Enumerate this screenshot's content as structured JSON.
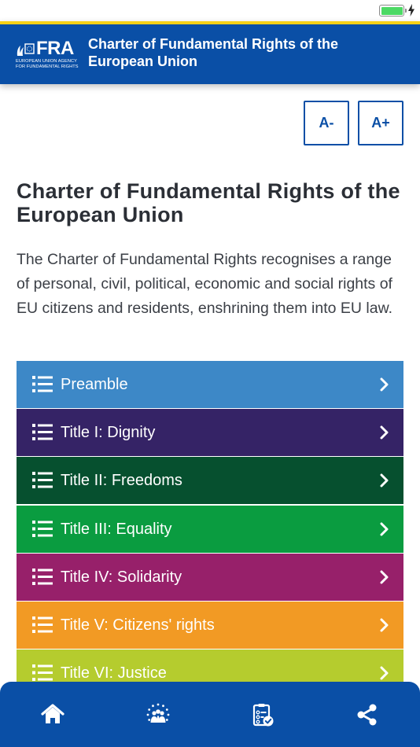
{
  "header": {
    "logo_text": "FRA",
    "logo_subtext_line1": "EUROPEAN UNION AGENCY",
    "logo_subtext_line2": "FOR FUNDAMENTAL RIGHTS",
    "title_line1": "Charter of Fundamental Rights of the",
    "title_line2": "European Union"
  },
  "font_controls": {
    "decrease_label": "A-",
    "increase_label": "A+"
  },
  "main": {
    "title": "Charter of Fundamental Rights of the European Union",
    "description": "The Charter of Fundamental Rights recognises a range of personal, civil, political, economic and social rights of EU citizens and residents, enshrining them into EU law."
  },
  "menu": {
    "items": [
      {
        "label": "Preamble",
        "color": "#3d88c7"
      },
      {
        "label": "Title I: Dignity",
        "color": "#352366"
      },
      {
        "label": "Title II: Freedoms",
        "color": "#06502f"
      },
      {
        "label": "Title III: Equality",
        "color": "#0a9c40"
      },
      {
        "label": "Title IV: Solidarity",
        "color": "#97206a"
      },
      {
        "label": "Title V: Citizens' rights",
        "color": "#f29a24"
      },
      {
        "label": "Title VI: Justice",
        "color": "#b5cc2e"
      }
    ]
  },
  "bottom_nav": {
    "items": [
      {
        "icon": "home-icon"
      },
      {
        "icon": "eu-community-icon"
      },
      {
        "icon": "checklist-icon"
      },
      {
        "icon": "share-icon"
      }
    ]
  },
  "colors": {
    "header_blue": "#0a4fa6",
    "accent_yellow": "#f7d117"
  }
}
